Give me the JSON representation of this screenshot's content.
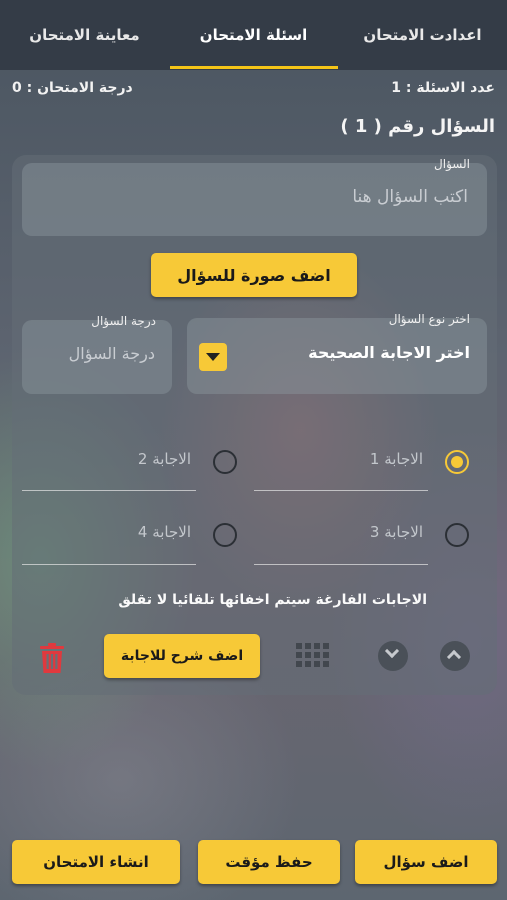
{
  "tabs": [
    {
      "label": "معاينة الامتحان"
    },
    {
      "label": "اسئلة الامتحان"
    },
    {
      "label": "اعدادت الامتحان"
    }
  ],
  "summary": {
    "exam_grade": "درجة الامتحان : 0",
    "questions_count": "عدد الاسئلة : 1"
  },
  "question": {
    "title": "السؤال رقم ( 1 )",
    "text_label": "السؤال",
    "text_placeholder": "اكتب السؤال هنا",
    "add_image_label": "اضف صورة للسؤال",
    "type_label": "اختر نوع السؤال",
    "type_value": "اختر الاجابة الصحيحة",
    "grade_label": "درجة السؤال",
    "grade_placeholder": "درجة السؤال"
  },
  "answers": [
    {
      "label": "الاجابة 1",
      "selected": true
    },
    {
      "label": "الاجابة 2",
      "selected": false
    },
    {
      "label": "الاجابة 3",
      "selected": false
    },
    {
      "label": "الاجابة 4",
      "selected": false
    }
  ],
  "note": "الاجابات الفارغة سيتم اخفائها تلقائيا لا تقلق",
  "add_explanation_label": "اضف شرح للاجابة",
  "footer": {
    "add_question": "اضف سؤال",
    "save_draft": "حفظ مؤقت",
    "create_exam": "انشاء الامتحان"
  },
  "colors": {
    "accent": "#f7c937",
    "topbar": "#343c47",
    "delete": "#e0393e"
  },
  "icons": {
    "dropdown": "caret-down-icon",
    "up": "chevron-up-icon",
    "down": "chevron-down-icon",
    "grid": "grid-icon",
    "delete": "trash-icon"
  }
}
